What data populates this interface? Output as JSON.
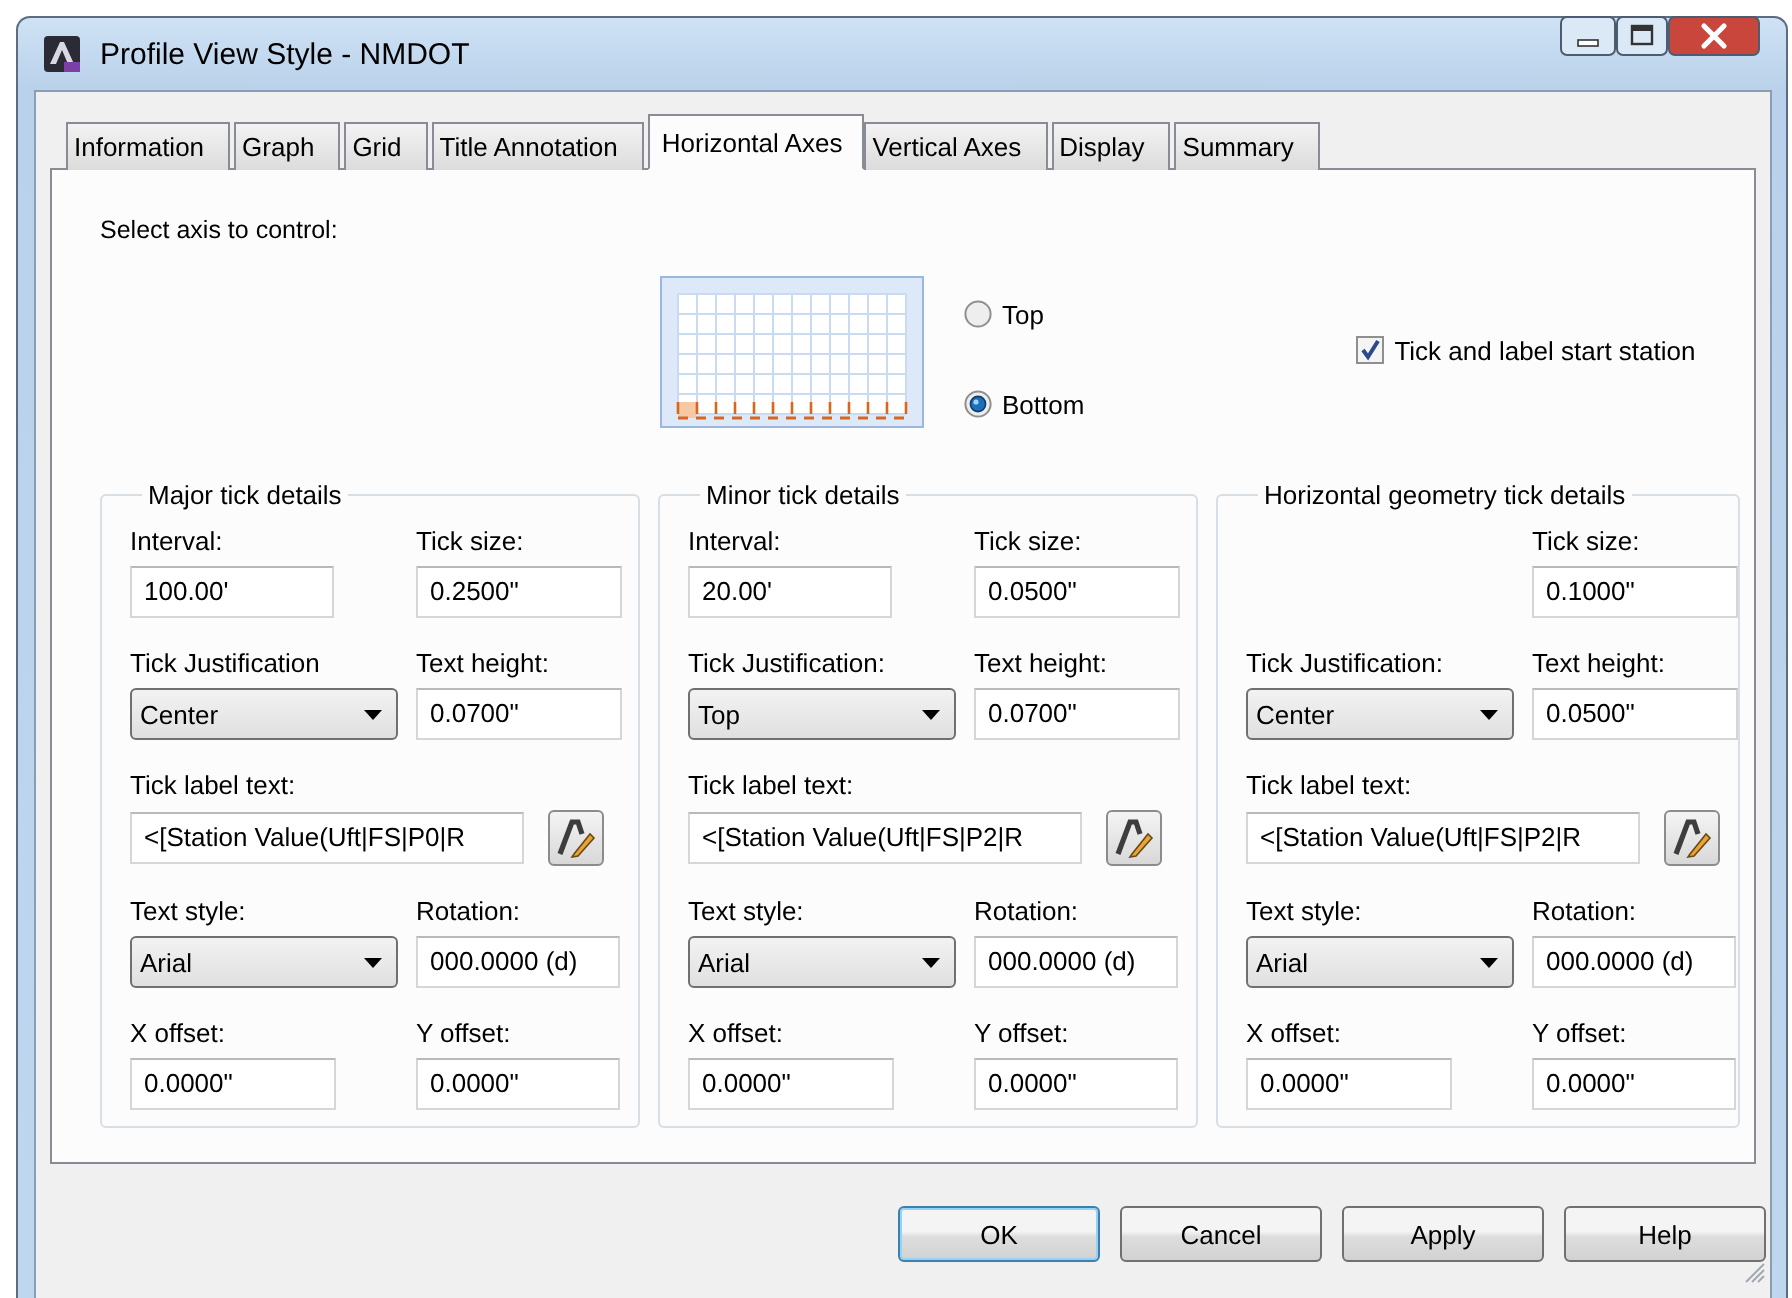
{
  "window": {
    "title": "Profile View Style - NMDOT"
  },
  "tabs": [
    {
      "label": "Information",
      "selected": false
    },
    {
      "label": "Graph",
      "selected": false
    },
    {
      "label": "Grid",
      "selected": false
    },
    {
      "label": "Title Annotation",
      "selected": false
    },
    {
      "label": "Horizontal Axes",
      "selected": true
    },
    {
      "label": "Vertical Axes",
      "selected": false
    },
    {
      "label": "Display",
      "selected": false
    },
    {
      "label": "Summary",
      "selected": false
    }
  ],
  "axis_select": {
    "label": "Select axis to control:",
    "options": [
      {
        "label": "Top",
        "selected": false
      },
      {
        "label": "Bottom",
        "selected": true
      }
    ],
    "start_station": {
      "label": "Tick and label start station",
      "checked": true
    }
  },
  "groups": [
    {
      "title": "Major tick details",
      "interval": {
        "label": "Interval:",
        "value": "100.00'"
      },
      "tick_size": {
        "label": "Tick size:",
        "value": "0.2500\""
      },
      "tick_justification": {
        "label": "Tick Justification",
        "value": "Center"
      },
      "text_height": {
        "label": "Text height:",
        "value": "0.0700\""
      },
      "tick_label_text": {
        "label": "Tick label text:",
        "value": "<[Station Value(Uft|FS|P0|R"
      },
      "text_style": {
        "label": "Text style:",
        "value": "Arial"
      },
      "rotation": {
        "label": "Rotation:",
        "value": "000.0000 (d)"
      },
      "x_offset": {
        "label": "X offset:",
        "value": "0.0000\""
      },
      "y_offset": {
        "label": "Y offset:",
        "value": "0.0000\""
      }
    },
    {
      "title": "Minor tick details",
      "interval": {
        "label": "Interval:",
        "value": "20.00'"
      },
      "tick_size": {
        "label": "Tick size:",
        "value": "0.0500\""
      },
      "tick_justification": {
        "label": "Tick Justification:",
        "value": "Top"
      },
      "text_height": {
        "label": "Text height:",
        "value": "0.0700\""
      },
      "tick_label_text": {
        "label": "Tick label text:",
        "value": "<[Station Value(Uft|FS|P2|R"
      },
      "text_style": {
        "label": "Text style:",
        "value": "Arial"
      },
      "rotation": {
        "label": "Rotation:",
        "value": "000.0000 (d)"
      },
      "x_offset": {
        "label": "X offset:",
        "value": "0.0000\""
      },
      "y_offset": {
        "label": "Y offset:",
        "value": "0.0000\""
      }
    },
    {
      "title": "Horizontal geometry tick details",
      "tick_size": {
        "label": "Tick size:",
        "value": "0.1000\""
      },
      "tick_justification": {
        "label": "Tick Justification:",
        "value": "Center"
      },
      "text_height": {
        "label": "Text height:",
        "value": "0.0500\""
      },
      "tick_label_text": {
        "label": "Tick label text:",
        "value": "<[Station Value(Uft|FS|P2|R"
      },
      "text_style": {
        "label": "Text style:",
        "value": "Arial"
      },
      "rotation": {
        "label": "Rotation:",
        "value": "000.0000 (d)"
      },
      "x_offset": {
        "label": "X offset:",
        "value": "0.0000\""
      },
      "y_offset": {
        "label": "Y offset:",
        "value": "0.0000\""
      }
    }
  ],
  "buttons": [
    {
      "label": "OK",
      "default": true
    },
    {
      "label": "Cancel",
      "default": false
    },
    {
      "label": "Apply",
      "default": false
    },
    {
      "label": "Help",
      "default": false
    }
  ]
}
